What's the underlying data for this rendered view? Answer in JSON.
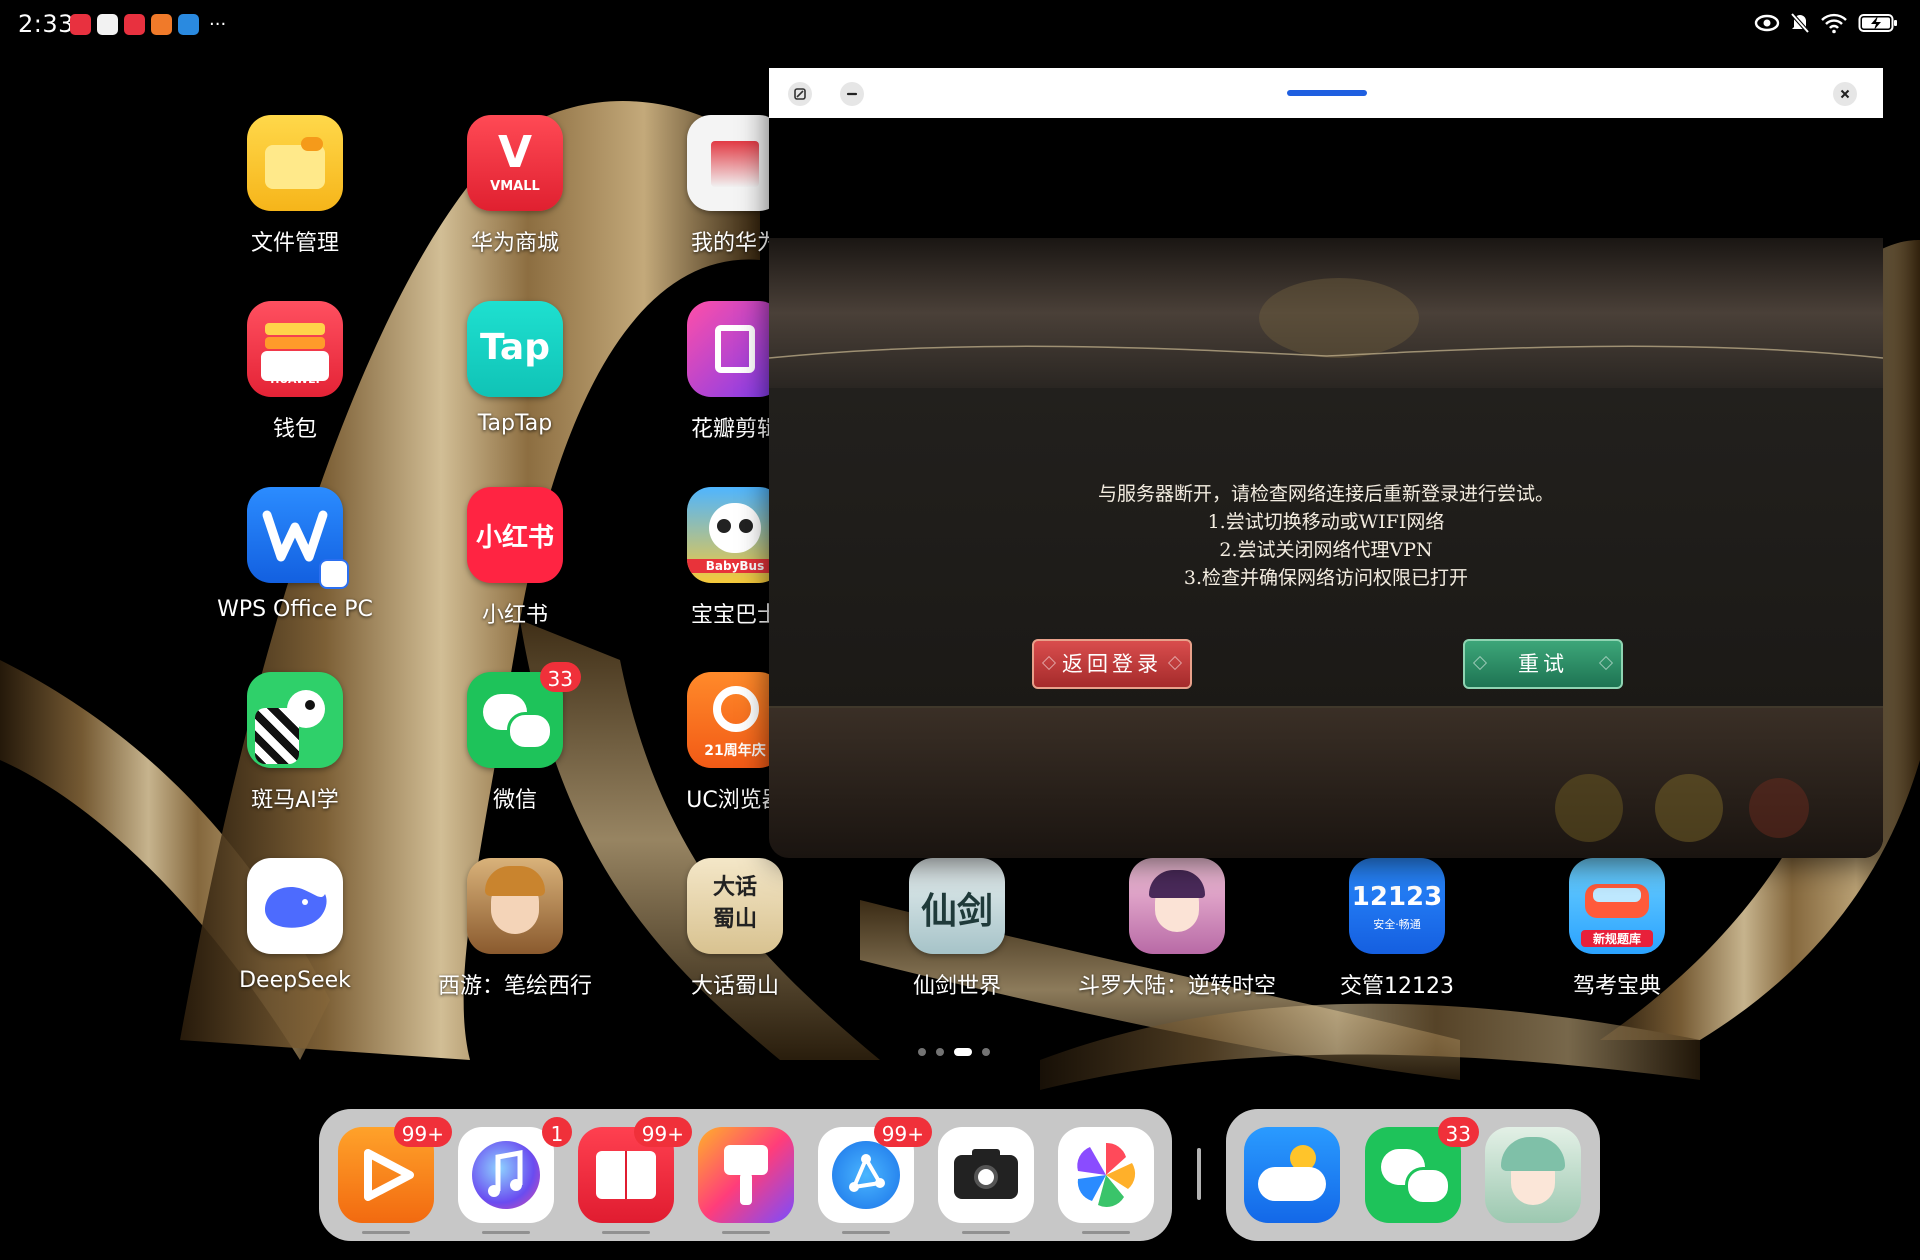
{
  "status_bar": {
    "time": "2:33",
    "notification_icons": [
      "vmall-notification-icon",
      "chat-notification-icon",
      "vmall-notification-icon",
      "uc-notification-icon",
      "browser-notification-icon"
    ],
    "more": "···"
  },
  "apps": [
    {
      "label": "文件管理",
      "icon": "folder-icon"
    },
    {
      "label": "华为商城",
      "icon": "vmall-icon",
      "icon_text": "VMALL"
    },
    {
      "label": "我的华为",
      "icon": "my-huawei-icon"
    },
    {
      "label": "钱包",
      "icon": "wallet-icon",
      "icon_text": "HUAWEI"
    },
    {
      "label": "TapTap",
      "icon": "taptap-icon",
      "icon_text": "Tap"
    },
    {
      "label": "花瓣剪辑",
      "icon": "petal-clip-icon"
    },
    {
      "label": "WPS Office PC",
      "icon": "wps-icon"
    },
    {
      "label": "小红书",
      "icon": "xiaohongshu-icon",
      "icon_text": "小红书"
    },
    {
      "label": "宝宝巴士",
      "icon": "babybus-icon",
      "icon_text": "BabyBus"
    },
    {
      "label": "斑马AI学",
      "icon": "zebra-icon"
    },
    {
      "label": "微信",
      "icon": "wechat-icon",
      "badge": "33"
    },
    {
      "label": "UC浏览器",
      "icon": "uc-browser-icon",
      "icon_text": "21周年庆"
    },
    {
      "label": "DeepSeek",
      "icon": "deepseek-icon"
    },
    {
      "label": "西游：笔绘西行",
      "icon": "xiyou-game-icon"
    },
    {
      "label": "大话蜀山",
      "icon": "dahua-shushan-icon",
      "icon_text": "大话蜀山"
    },
    {
      "label": "仙剑世界",
      "icon": "xianjian-icon",
      "icon_text": "仙剑"
    },
    {
      "label": "斗罗大陆：逆转时空",
      "icon": "douluo-icon"
    },
    {
      "label": "交管12123",
      "icon": "traffic-12123-icon",
      "icon_text": "12123",
      "icon_subtext": "安全·畅通"
    },
    {
      "label": "驾考宝典",
      "icon": "driving-test-icon",
      "icon_text": "新规题库"
    }
  ],
  "window": {
    "message_lines": [
      "与服务器断开，请检查网络连接后重新登录进行尝试。",
      "1.尝试切换移动或WIFI网络",
      "2.尝试关闭网络代理VPN",
      "3.检查并确保网络访问权限已打开"
    ],
    "back_label": "返回登录",
    "retry_label": "重试"
  },
  "dock": [
    {
      "icon": "video-icon",
      "badge": "99+"
    },
    {
      "icon": "music-icon",
      "badge": "1"
    },
    {
      "icon": "books-icon",
      "badge": "99+"
    },
    {
      "icon": "themes-icon"
    },
    {
      "icon": "browser-icon",
      "badge": "99+"
    },
    {
      "icon": "camera-icon"
    },
    {
      "icon": "gallery-icon"
    },
    {
      "icon": "weather-icon"
    },
    {
      "icon": "wechat-icon",
      "badge": "33"
    },
    {
      "icon": "game-character-icon"
    }
  ],
  "colors": {
    "badge": "#f0303a",
    "window_handle": "#1f5fe0",
    "back_button": "#c23a3a",
    "retry_button": "#2a8c62"
  }
}
